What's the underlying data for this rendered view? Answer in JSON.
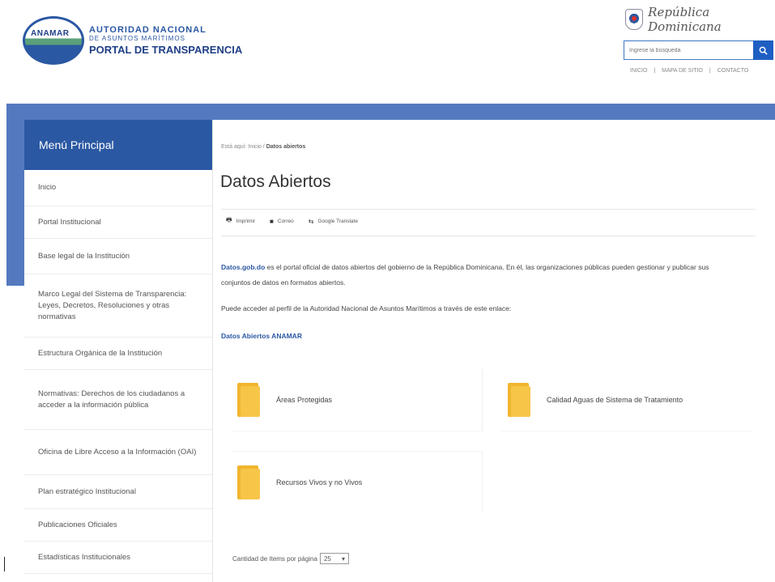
{
  "header": {
    "logo_acronym": "ANAMAR",
    "logo_line1": "AUTORIDAD NACIONAL",
    "logo_line2": "DE ASUNTOS MARÍTIMOS",
    "logo_portal": "PORTAL DE TRANSPARENCIA",
    "republic_text": "República Dominicana",
    "search_placeholder": "Ingrese la búsqueda",
    "top_links": [
      "INICIO",
      "|",
      "MAPA DE SITIO",
      "|",
      "CONTACTO"
    ]
  },
  "sidebar": {
    "title": "Menú Principal",
    "items": [
      {
        "label": "Inicio",
        "h": 45
      },
      {
        "label": "Portal Institucional",
        "h": 40
      },
      {
        "label": "Base legal de la Institución",
        "h": 44
      },
      {
        "label": "Marco Legal del Sistema de Transparencia: Leyes, Decretos, Resoluciones y otras normativas",
        "h": 78
      },
      {
        "label": "Estructura Orgánica de la Institución",
        "h": 40
      },
      {
        "label": "Normativas: Derechos de los ciudadanos a acceder a la información pública",
        "h": 74
      },
      {
        "label": "Oficina de Libre Acceso a la Información (OAI)",
        "h": 56
      },
      {
        "label": "Plan estratégico Institucional",
        "h": 42
      },
      {
        "label": "Publicaciones Oficiales",
        "h": 40
      },
      {
        "label": "Estadísticas Institucionales",
        "h": 40
      }
    ]
  },
  "main": {
    "breadcrumb_prefix": "Está aquí:",
    "breadcrumb_home": "Inicio",
    "breadcrumb_sep": "/",
    "breadcrumb_current": "Datos abiertos",
    "title": "Datos Abiertos",
    "tools": [
      {
        "icon": "print-icon",
        "label": "Imprimir"
      },
      {
        "icon": "email-icon",
        "label": "Correo"
      },
      {
        "icon": "google-translate-icon",
        "label": "Google Translate"
      }
    ],
    "intro_link": "Datos.gob.do",
    "intro_text": " es el portal oficial de datos abiertos del gobierno de la República Dominicana. En él, las organizaciones públicas pueden gestionar y publicar sus conjuntos de datos en formatos abiertos.",
    "access_text": "Puede acceder al perfil de la Autoridad Nacional de Asuntos Marítimos a través de este enlace:",
    "profile_link": "Datos Abiertos ANAMAR",
    "folders": [
      "Áreas Protegidas",
      "Calidad Aguas de Sistema de Tratamiento",
      "Recursos Vivos y no Vivos"
    ],
    "per_page_label": "Cantidad de ítems por página",
    "per_page_value": "25"
  },
  "colors": {
    "brand_blue": "#2b58a3",
    "bar_blue": "#5579bf",
    "folder_yellow": "#f7c548"
  }
}
